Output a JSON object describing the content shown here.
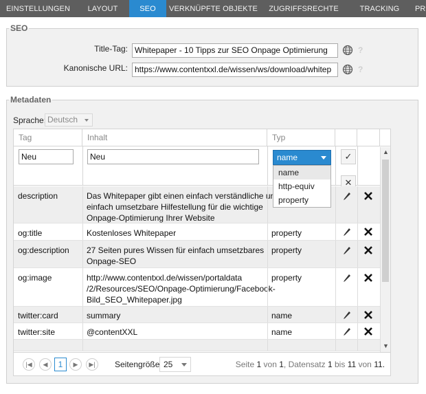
{
  "tabs": [
    {
      "label": "EINSTELLUNGEN",
      "active": false
    },
    {
      "label": "LAYOUT",
      "active": false
    },
    {
      "label": "SEO",
      "active": true
    },
    {
      "label": "VERKNÜPFTE OBJEKTE",
      "active": false
    },
    {
      "label": "ZUGRIFFSRECHTE",
      "active": false
    },
    {
      "label": "TRACKING",
      "active": false
    },
    {
      "label": "PRO",
      "active": false
    }
  ],
  "seo": {
    "legend": "SEO",
    "title_label": "Title-Tag:",
    "title_value": "Whitepaper - 10 Tipps zur SEO Onpage Optimierung",
    "canonical_label": "Kanonische URL:",
    "canonical_value": "https://www.contentxxl.de/wissen/ws/download/whitep",
    "help": "?"
  },
  "meta": {
    "legend": "Metadaten",
    "language_label": "Sprache:",
    "language_value": "Deutsch",
    "columns": {
      "tag": "Tag",
      "content": "Inhalt",
      "type": "Typ"
    },
    "edit": {
      "tag_value": "Neu",
      "content_value": "Neu",
      "type_value": "name",
      "type_options": [
        "name",
        "http-equiv",
        "property"
      ],
      "confirm_icon": "✓",
      "cancel_icon": "✕"
    },
    "rows": [
      {
        "tag": "description",
        "content": [
          "Das Whitepaper gibt einen einfach verständliche und",
          "einfach umsetzbare Hilfestellung für die wichtige",
          "Onpage-Optimierung Ihrer Website"
        ],
        "type": ""
      },
      {
        "tag": "og:title",
        "content": [
          "Kostenloses Whitepaper"
        ],
        "type": "property"
      },
      {
        "tag": "og:description",
        "content": [
          "27 Seiten pures Wissen für einfach umsetzbares",
          "Onpage-SEO"
        ],
        "type": "property"
      },
      {
        "tag": "og:image",
        "content": [
          "http://www.contentxxl.de/wissen/portaldata",
          "/2/Resources/SEO/Onpage-Optimierung/Facebook-",
          "Bild_SEO_Whitepaper.jpg"
        ],
        "type": "property"
      },
      {
        "tag": "twitter:card",
        "content": [
          "summary"
        ],
        "type": "name"
      },
      {
        "tag": "twitter:site",
        "content": [
          "@contentXXL"
        ],
        "type": "name"
      }
    ]
  },
  "pager": {
    "current_page": "1",
    "page_size_label": "Seitengröße:",
    "page_size": "25",
    "info": {
      "seite": "Seite",
      "page": "1",
      "von": "von",
      "pages": "1",
      "datensatz": ", Datensatz",
      "from": "1",
      "bis": "bis",
      "to": "11",
      "von2": "von",
      "total": "11."
    }
  },
  "colors": {
    "tab_bar": "#5e5e5e",
    "accent": "#2a8ad0",
    "panel_bg": "#f1f1f1"
  }
}
